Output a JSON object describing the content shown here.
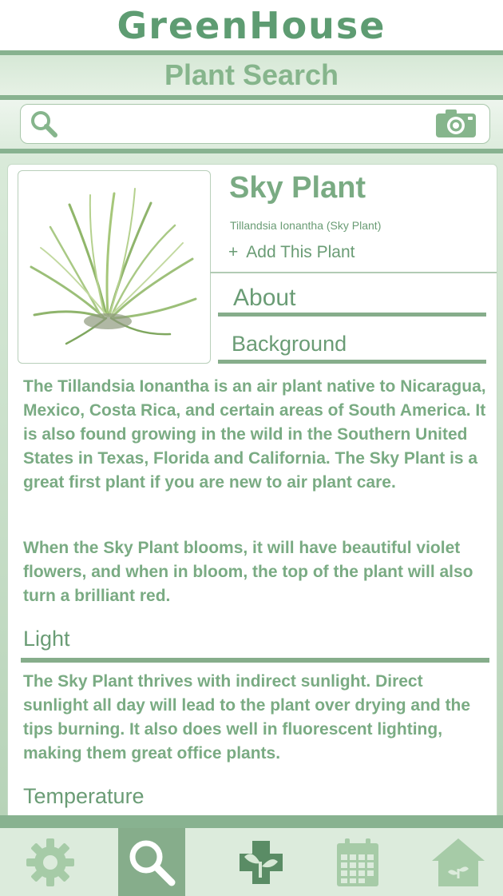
{
  "app": {
    "logo": "GreenHouse",
    "page_title": "Plant Search"
  },
  "search": {
    "value": "",
    "placeholder": ""
  },
  "plant": {
    "name": "Sky Plant",
    "scientific": "Tillandsia Ionantha (Sky Plant)",
    "add_plus": "+",
    "add_label": "Add This Plant"
  },
  "sections": {
    "about": "About",
    "background": "Background",
    "light": "Light",
    "temperature": "Temperature"
  },
  "content": {
    "background_p1": "The Tillandsia Ionantha is an air plant native to Nicaragua, Mexico, Costa Rica, and certain areas of South America. It is also found growing in the wild in the Southern United States in Texas, Florida and California. The Sky Plant is a great first plant if you are new to air plant care.",
    "background_p2": "When the Sky Plant blooms, it will have beautiful violet flowers, and when in bloom, the top of the plant will also turn a brilliant red.",
    "light_p1": "The Sky Plant thrives with indirect sunlight. Direct sunlight all day will lead to the plant over drying and the tips burning. It also does well in fluorescent lighting, making them great office plants."
  },
  "tabs": [
    {
      "icon": "gear-icon",
      "active": false
    },
    {
      "icon": "search-icon",
      "active": true
    },
    {
      "icon": "plant-care-icon",
      "active": false
    },
    {
      "icon": "calendar-icon",
      "active": false
    },
    {
      "icon": "greenhouse-icon",
      "active": false
    }
  ],
  "colors": {
    "accent": "#7aab83",
    "dark_accent": "#5e9c72",
    "active_tab": "#86ad8b",
    "bar": "#88b290"
  }
}
